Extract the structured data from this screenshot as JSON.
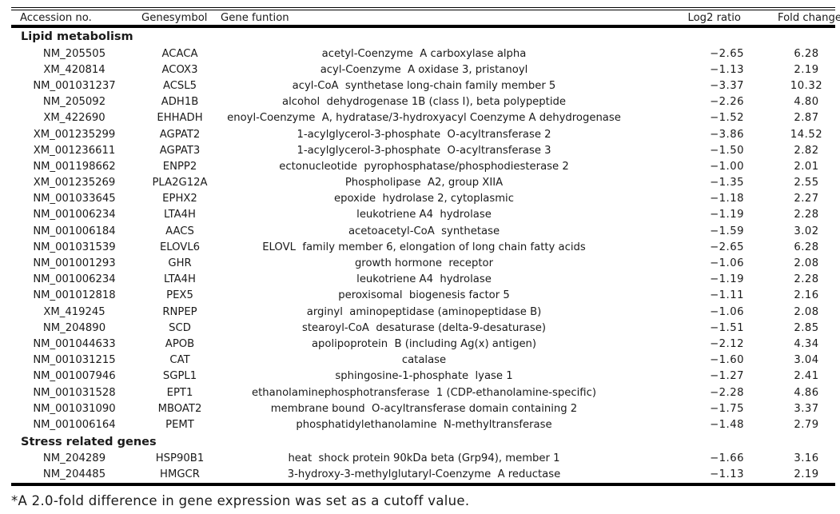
{
  "table": {
    "headers": {
      "accession": "Accession no.",
      "symbol": "Genesymbol",
      "function": "Gene funtion",
      "log2": "Log2 ratio",
      "fold": "Fold change"
    },
    "sections": [
      {
        "title": "Lipid metabolism",
        "rows": [
          {
            "accession": "NM_205505",
            "symbol": "ACACA",
            "function": "acetyl-Coenzyme  A carboxylase alpha",
            "log2": "−2.65",
            "fold": "6.28"
          },
          {
            "accession": "XM_420814",
            "symbol": "ACOX3",
            "function": "acyl-Coenzyme  A oxidase 3, pristanoyl",
            "log2": "−1.13",
            "fold": "2.19"
          },
          {
            "accession": "NM_001031237",
            "symbol": "ACSL5",
            "function": "acyl-CoA  synthetase long-chain family member 5",
            "log2": "−3.37",
            "fold": "10.32"
          },
          {
            "accession": "NM_205092",
            "symbol": "ADH1B",
            "function": "alcohol  dehydrogenase 1B (class I), beta polypeptide",
            "log2": "−2.26",
            "fold": "4.80"
          },
          {
            "accession": "XM_422690",
            "symbol": "EHHADH",
            "function": "enoyl-Coenzyme  A, hydratase/3-hydroxyacyl Coenzyme A dehydrogenase",
            "log2": "−1.52",
            "fold": "2.87"
          },
          {
            "accession": "XM_001235299",
            "symbol": "AGPAT2",
            "function": "1-acylglycerol-3-phosphate  O-acyltransferase 2",
            "log2": "−3.86",
            "fold": "14.52"
          },
          {
            "accession": "XM_001236611",
            "symbol": "AGPAT3",
            "function": "1-acylglycerol-3-phosphate  O-acyltransferase 3",
            "log2": "−1.50",
            "fold": "2.82"
          },
          {
            "accession": "NM_001198662",
            "symbol": "ENPP2",
            "function": "ectonucleotide  pyrophosphatase/phosphodiesterase 2",
            "log2": "−1.00",
            "fold": "2.01"
          },
          {
            "accession": "XM_001235269",
            "symbol": "PLA2G12A",
            "function": "Phospholipase  A2, group XIIA",
            "log2": "−1.35",
            "fold": "2.55"
          },
          {
            "accession": "NM_001033645",
            "symbol": "EPHX2",
            "function": "epoxide  hydrolase 2, cytoplasmic",
            "log2": "−1.18",
            "fold": "2.27"
          },
          {
            "accession": "NM_001006234",
            "symbol": "LTA4H",
            "function": "leukotriene A4  hydrolase",
            "log2": "−1.19",
            "fold": "2.28"
          },
          {
            "accession": "NM_001006184",
            "symbol": "AACS",
            "function": "acetoacetyl-CoA  synthetase",
            "log2": "−1.59",
            "fold": "3.02"
          },
          {
            "accession": "NM_001031539",
            "symbol": "ELOVL6",
            "function": "ELOVL  family member 6, elongation of long chain fatty acids",
            "log2": "−2.65",
            "fold": "6.28"
          },
          {
            "accession": "NM_001001293",
            "symbol": "GHR",
            "function": "growth hormone  receptor",
            "log2": "−1.06",
            "fold": "2.08"
          },
          {
            "accession": "NM_001006234",
            "symbol": "LTA4H",
            "function": "leukotriene A4  hydrolase",
            "log2": "−1.19",
            "fold": "2.28"
          },
          {
            "accession": "NM_001012818",
            "symbol": "PEX5",
            "function": "peroxisomal  biogenesis factor 5",
            "log2": "−1.11",
            "fold": "2.16"
          },
          {
            "accession": "XM_419245",
            "symbol": "RNPEP",
            "function": "arginyl  aminopeptidase (aminopeptidase B)",
            "log2": "−1.06",
            "fold": "2.08"
          },
          {
            "accession": "NM_204890",
            "symbol": "SCD",
            "function": "stearoyl-CoA  desaturase (delta-9-desaturase)",
            "log2": "−1.51",
            "fold": "2.85"
          },
          {
            "accession": "NM_001044633",
            "symbol": "APOB",
            "function": "apolipoprotein  B (including Ag(x) antigen)",
            "log2": "−2.12",
            "fold": "4.34"
          },
          {
            "accession": "NM_001031215",
            "symbol": "CAT",
            "function": "catalase",
            "log2": "−1.60",
            "fold": "3.04"
          },
          {
            "accession": "NM_001007946",
            "symbol": "SGPL1",
            "function": "sphingosine-1-phosphate  lyase 1",
            "log2": "−1.27",
            "fold": "2.41"
          },
          {
            "accession": "NM_001031528",
            "symbol": "EPT1",
            "function": "ethanolaminephosphotransferase  1 (CDP-ethanolamine-specific)",
            "log2": "−2.28",
            "fold": "4.86"
          },
          {
            "accession": "NM_001031090",
            "symbol": "MBOAT2",
            "function": "membrane bound  O-acyltransferase domain containing 2",
            "log2": "−1.75",
            "fold": "3.37"
          },
          {
            "accession": "NM_001006164",
            "symbol": "PEMT",
            "function": "phosphatidylethanolamine  N-methyltransferase",
            "log2": "−1.48",
            "fold": "2.79"
          }
        ]
      },
      {
        "title": "Stress related genes",
        "rows": [
          {
            "accession": "NM_204289",
            "symbol": "HSP90B1",
            "function": "heat  shock protein 90kDa beta (Grp94), member 1",
            "log2": "−1.66",
            "fold": "3.16"
          },
          {
            "accession": "NM_204485",
            "symbol": "HMGCR",
            "function": "3-hydroxy-3-methylglutaryl-Coenzyme  A reductase",
            "log2": "−1.13",
            "fold": "2.19"
          }
        ]
      }
    ]
  },
  "footnote": "*A 2.0-fold difference in gene expression was set as a cutoff value."
}
